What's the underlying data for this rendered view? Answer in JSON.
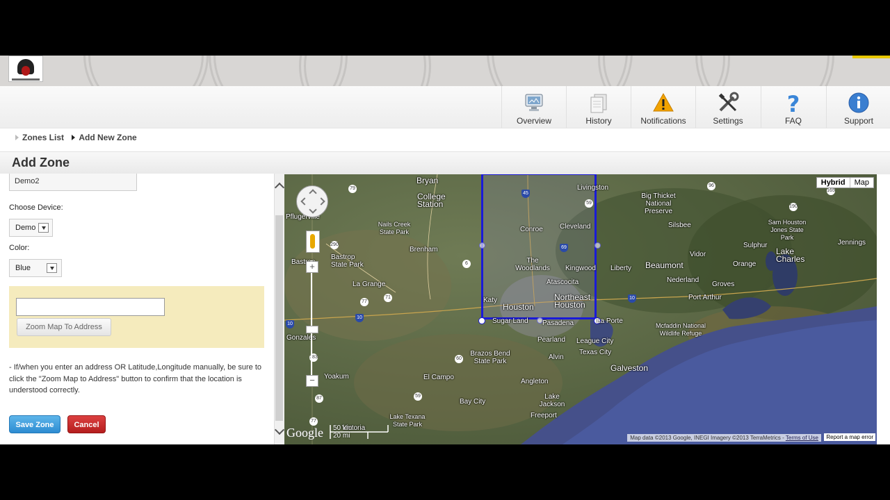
{
  "nav": {
    "items": [
      {
        "label": "Overview",
        "icon": "monitor-icon"
      },
      {
        "label": "History",
        "icon": "documents-icon"
      },
      {
        "label": "Notifications",
        "icon": "warning-icon"
      },
      {
        "label": "Settings",
        "icon": "tools-icon"
      },
      {
        "label": "FAQ",
        "icon": "question-icon"
      },
      {
        "label": "Support",
        "icon": "info-icon"
      }
    ]
  },
  "breadcrumb": {
    "items": [
      "Zones List",
      "Add New Zone"
    ]
  },
  "page": {
    "title": "Add Zone"
  },
  "form": {
    "zone_name_value": "Demo2",
    "device_label": "Choose Device:",
    "device_value": "Demo",
    "color_label": "Color:",
    "color_value": "Blue",
    "address_value": "",
    "zoom_button": "Zoom Map To Address",
    "note": "- If/when you enter an address OR Latitude,Longitude manually, be sure to click the \"Zoom Map to Address\" button to confirm that the location is understood correctly.",
    "save_button": "Save Zone",
    "cancel_button": "Cancel"
  },
  "map": {
    "type_hybrid": "Hybrid",
    "type_map": "Map",
    "scale_km": "50 km",
    "scale_mi": "20 mi",
    "google": "Google",
    "copyright": "Map data ©2013 Google, INEGI Imagery ©2013 TerraMetrics - ",
    "terms": "Terms of Use",
    "report": "Report a map error",
    "zone_color": "#1a1ad8",
    "places": [
      {
        "name": "Bryan"
      },
      {
        "name": "College Station"
      },
      {
        "name": "Livingston"
      },
      {
        "name": "Big Thicket National Preserve"
      },
      {
        "name": "Conroe"
      },
      {
        "name": "Cleveland"
      },
      {
        "name": "Silsbee"
      },
      {
        "name": "Pflugerville"
      },
      {
        "name": "Nails Creek State Park"
      },
      {
        "name": "Brenham"
      },
      {
        "name": "Bastrop State Park"
      },
      {
        "name": "Bastrop"
      },
      {
        "name": "La Grange"
      },
      {
        "name": "The Woodlands"
      },
      {
        "name": "Kingwood"
      },
      {
        "name": "Atascocita"
      },
      {
        "name": "Liberty"
      },
      {
        "name": "Beaumont"
      },
      {
        "name": "Vidor"
      },
      {
        "name": "Orange"
      },
      {
        "name": "Sulphur"
      },
      {
        "name": "Lake Charles"
      },
      {
        "name": "Jennings"
      },
      {
        "name": "Sam Houston Jones State Park"
      },
      {
        "name": "Nederland"
      },
      {
        "name": "Groves"
      },
      {
        "name": "Port Arthur"
      },
      {
        "name": "Katy"
      },
      {
        "name": "Houston"
      },
      {
        "name": "Northeast Houston"
      },
      {
        "name": "Sugar Land"
      },
      {
        "name": "Pasadena"
      },
      {
        "name": "La Porte"
      },
      {
        "name": "Pearland"
      },
      {
        "name": "League City"
      },
      {
        "name": "Texas City"
      },
      {
        "name": "Galveston"
      },
      {
        "name": "Mcfaddin National Wildlife Refuge"
      },
      {
        "name": "Gonzales"
      },
      {
        "name": "Brazos Bend State Park"
      },
      {
        "name": "Alvin"
      },
      {
        "name": "El Campo"
      },
      {
        "name": "Yoakum"
      },
      {
        "name": "Angleton"
      },
      {
        "name": "Bay City"
      },
      {
        "name": "Lake Jackson"
      },
      {
        "name": "Freeport"
      },
      {
        "name": "Lake Texana State Park"
      },
      {
        "name": "Victoria"
      }
    ],
    "shields": [
      "79",
      "290",
      "6",
      "77",
      "71",
      "10",
      "45",
      "59",
      "69",
      "10",
      "96",
      "190",
      "165",
      "60",
      "59",
      "87",
      "77",
      "10",
      "183"
    ]
  }
}
